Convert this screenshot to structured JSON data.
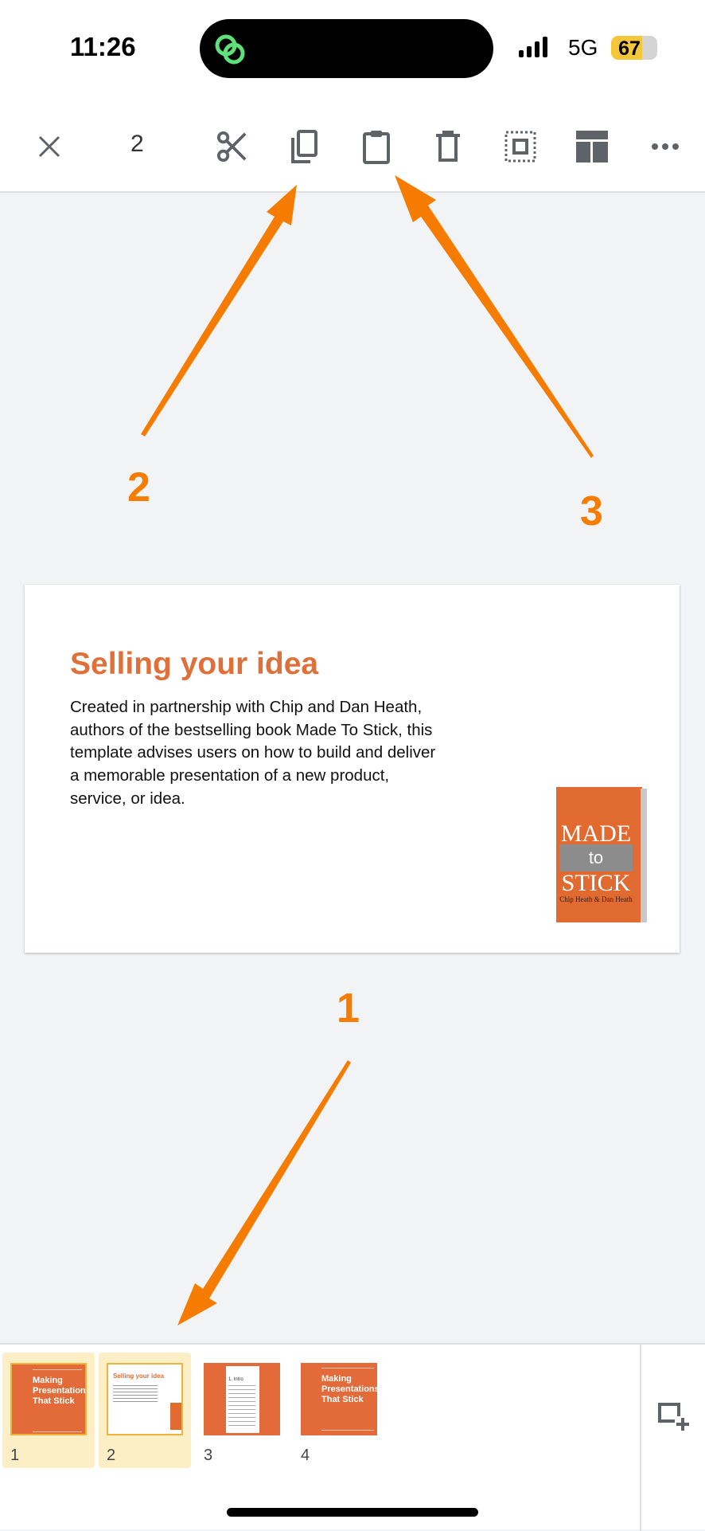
{
  "status_bar": {
    "time": "11:26",
    "network": "5G",
    "battery": "67",
    "battery_level": 67
  },
  "toolbar": {
    "selected_count": "2",
    "icons": [
      "close-icon",
      "cut-icon",
      "copy-icon",
      "paste-icon",
      "delete-icon",
      "select-all-icon",
      "layout-icon",
      "more-icon"
    ]
  },
  "slide": {
    "title": "Selling your idea",
    "body": "Created in partnership with Chip and Dan Heath, authors of the bestselling book Made To Stick, this template advises users on how to build and deliver a memorable presentation of a new product, service, or idea.",
    "book_cover": "MADE to STICK Chip Heath & Dan Heath"
  },
  "annotations": {
    "one": "1",
    "two": "2",
    "three": "3",
    "color": "#f57c00"
  },
  "filmstrip": {
    "items": [
      {
        "number": "1",
        "title": "Making Presentations That Stick",
        "selected": true
      },
      {
        "number": "2",
        "title": "Selling your idea",
        "selected": true
      },
      {
        "number": "3",
        "title": "1. Intro",
        "selected": false
      },
      {
        "number": "4",
        "title": "Making Presentations That Stick",
        "selected": false
      }
    ],
    "add_slide_icon": "add-slide-icon"
  },
  "colors": {
    "accent": "#e36b39",
    "selection": "#fcefc6",
    "background": "#f1f3f4"
  }
}
